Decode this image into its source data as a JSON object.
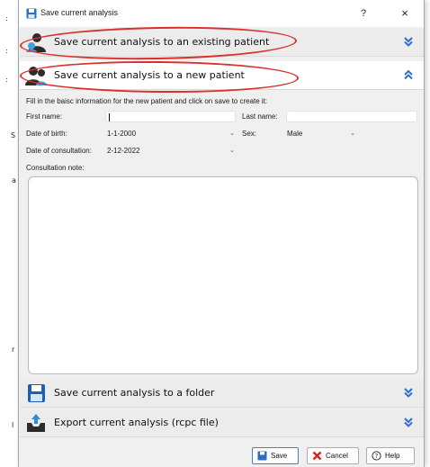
{
  "window": {
    "title": "Save current analysis",
    "help_glyph": "?",
    "close_glyph": "×"
  },
  "accordion": [
    {
      "label": "Save current analysis to an existing patient",
      "icon": "patient-icon",
      "state": "collapsed"
    },
    {
      "label": "Save current analysis to a new patient",
      "icon": "new-patient-icon",
      "state": "expanded"
    },
    {
      "label": "Save current analysis to a folder",
      "icon": "floppy-disk-icon",
      "state": "collapsed"
    },
    {
      "label": "Export current analysis (rcpc file)",
      "icon": "export-icon",
      "state": "collapsed"
    }
  ],
  "form": {
    "instructions": "Fill in the baisc information for the new patient and click on save to create it:",
    "first_name_label": "First name:",
    "first_name_value": "",
    "last_name_label": "Last name:",
    "last_name_value": "",
    "dob_label": "Date of birth:",
    "dob_value": "1-1-2000",
    "sex_label": "Sex:",
    "sex_value": "Male",
    "consultation_date_label": "Date of consultation:",
    "consultation_date_value": "2-12-2022",
    "note_label": "Consultation note:",
    "note_value": ""
  },
  "buttons": {
    "save": "Save",
    "cancel": "Cancel",
    "help": "Help"
  },
  "background_marks": [
    ":",
    ":",
    ":",
    "S",
    "a",
    "r",
    "l"
  ],
  "colors": {
    "highlight_ring": "#d9302c",
    "chevron_blue": "#2f6fd1",
    "cancel_red": "#d8201b",
    "default_button_border": "#3c7fd6"
  }
}
